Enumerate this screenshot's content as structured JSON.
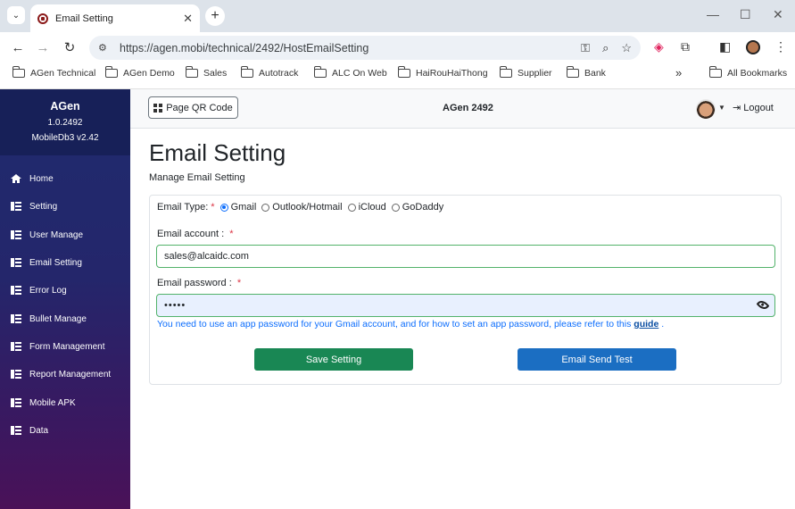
{
  "browser": {
    "tab_title": "Email Setting",
    "url": "https://agen.mobi/technical/2492/HostEmailSetting",
    "bookmarks": [
      "AGen Technical",
      "AGen Demo",
      "Sales",
      "Autotrack",
      "ALC On Web",
      "HaiRouHaiThong",
      "Supplier",
      "Bank"
    ],
    "all_bookmarks": "All Bookmarks",
    "overflow": "»"
  },
  "sidebar": {
    "title": "AGen",
    "version": "1.0.2492",
    "db": "MobileDb3 v2.42",
    "items": [
      {
        "label": "Home",
        "icon": "home-icon"
      },
      {
        "label": "Setting",
        "icon": "list-icon"
      },
      {
        "label": "User Manage",
        "icon": "list-icon"
      },
      {
        "label": "Email Setting",
        "icon": "list-icon"
      },
      {
        "label": "Error Log",
        "icon": "list-icon"
      },
      {
        "label": "Bullet Manage",
        "icon": "list-icon"
      },
      {
        "label": "Form Management",
        "icon": "list-icon"
      },
      {
        "label": "Report Management",
        "icon": "list-icon"
      },
      {
        "label": "Mobile APK",
        "icon": "list-icon"
      },
      {
        "label": "Data",
        "icon": "list-icon"
      }
    ]
  },
  "header": {
    "qr_button": "Page QR Code",
    "app_title": "AGen 2492",
    "logout": "Logout"
  },
  "page": {
    "title": "Email Setting",
    "subtitle": "Manage Email Setting"
  },
  "form": {
    "type_label": "Email Type:",
    "required_mark": "*",
    "types": [
      {
        "label": "Gmail",
        "checked": true
      },
      {
        "label": "Outlook/Hotmail",
        "checked": false
      },
      {
        "label": "iCloud",
        "checked": false
      },
      {
        "label": "GoDaddy",
        "checked": false
      }
    ],
    "account_label": "Email account :",
    "account_value": "sales@alcaidc.com",
    "password_label": "Email password :",
    "password_value": "•••••",
    "hint_text": "You need to use an app password for your Gmail account, and for how to set an app password, please refer to this",
    "hint_link": "guide",
    "hint_end": ".",
    "save_button": "Save Setting",
    "test_button": "Email Send Test"
  },
  "colors": {
    "sidebar_top": "#1f2b6e",
    "sidebar_bottom": "#4a1158",
    "save": "#198754",
    "test": "#1b6ec2",
    "input_border": "#52b26a"
  }
}
